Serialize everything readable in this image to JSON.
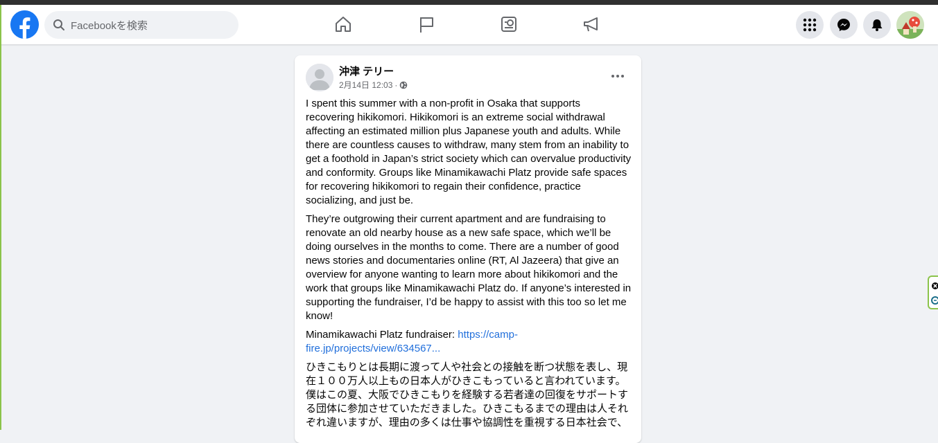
{
  "header": {
    "search_placeholder": "Facebookを検索",
    "nav": [
      {
        "icon": "home-icon"
      },
      {
        "icon": "flag-icon"
      },
      {
        "icon": "ad-center-icon"
      },
      {
        "icon": "megaphone-icon"
      }
    ],
    "right": [
      {
        "icon": "menu-grid-icon"
      },
      {
        "icon": "messenger-icon"
      },
      {
        "icon": "notifications-bell-icon"
      }
    ]
  },
  "post": {
    "author": "沖津 テリー",
    "timestamp": "2月14日 12:03",
    "separator": "·",
    "privacy_icon": "globe-icon",
    "paragraphs": [
      "I spent this summer with a non-profit in Osaka that supports recovering hikikomori. Hikikomori is an extreme social withdrawal affecting an estimated million plus Japanese youth and adults. While there are countless causes to withdraw, many stem from an inability to get a foothold in Japan’s strict society which can overvalue productivity and conformity. Groups like Minamikawachi Platz provide safe spaces for recovering hikikomori to regain their confidence, practice socializing, and just be.",
      "They’re outgrowing their current apartment and are fundraising to renovate an old nearby house as a new safe space, which we’ll be doing ourselves in the months to come. There are a number of good news stories and documentaries online (RT, Al Jazeera) that give an overview for anyone wanting to learn more about hikikomori and the work that groups like Minamikawachi Platz do. If anyone’s interested in supporting the fundraiser, I’d be happy to assist with this too so let me know!"
    ],
    "fundraiser_label": "Minamikawachi Platz fundraiser: ",
    "fundraiser_link": "https://camp-fire.jp/projects/view/634567...",
    "japanese_paragraph": "ひきこもりとは長期に渡って人や社会との接触を断つ状態を表し、現在１００万人以上もの日本人がひきこもっていると言われています。僕はこの夏、大阪でひきこもりを経験する若者達の回復をサポートする団体に参加させていただきました。ひきこもるまでの理由は人それぞれ違いますが、理由の多くは仕事や協調性を重視する日本社会で、"
  },
  "colors": {
    "brand": "#1877f2",
    "link": "#216fdb",
    "background": "#f0f2f5"
  }
}
